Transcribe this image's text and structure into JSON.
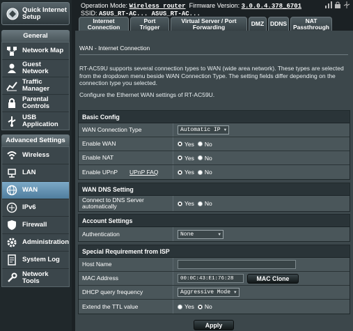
{
  "header": {
    "operation_mode_label": "Operation Mode:",
    "operation_mode_value": "Wireless router",
    "firmware_label": "Firmware Version:",
    "firmware_value": "3.0.0.4.378_6701",
    "ssid_label": "SSID:",
    "ssid_value": "ASUS_RT-AC...  ASUS_RT-AC..."
  },
  "sidebar": {
    "quick_setup_label": "Quick Internet\nSetup",
    "general_label": "General",
    "general_items": [
      {
        "label": "Network Map",
        "icon": "network-map-icon"
      },
      {
        "label": "Guest\nNetwork",
        "icon": "guest-network-icon"
      },
      {
        "label": "Traffic\nManager",
        "icon": "traffic-manager-icon"
      },
      {
        "label": "Parental\nControls",
        "icon": "parental-controls-icon"
      },
      {
        "label": "USB\nApplication",
        "icon": "usb-application-icon"
      }
    ],
    "advanced_label": "Advanced Settings",
    "advanced_items": [
      {
        "label": "Wireless",
        "icon": "wireless-icon"
      },
      {
        "label": "LAN",
        "icon": "lan-icon"
      },
      {
        "label": "WAN",
        "icon": "wan-icon",
        "active": true
      },
      {
        "label": "IPv6",
        "icon": "ipv6-icon"
      },
      {
        "label": "Firewall",
        "icon": "firewall-icon"
      },
      {
        "label": "Administration",
        "icon": "administration-icon"
      },
      {
        "label": "System Log",
        "icon": "system-log-icon"
      },
      {
        "label": "Network\nTools",
        "icon": "network-tools-icon"
      }
    ]
  },
  "tabs": [
    {
      "label": "Internet\nConnection",
      "active": true
    },
    {
      "label": "Port\nTrigger"
    },
    {
      "label": "Virtual Server / Port\nForwarding"
    },
    {
      "label": "DMZ"
    },
    {
      "label": "DDNS"
    },
    {
      "label": "NAT\nPassthrough"
    }
  ],
  "main": {
    "title": "WAN - Internet Connection",
    "description": "RT-AC59U supports several connection types to WAN (wide area network). These types are selected from the dropdown menu beside WAN Connection Type. The setting fields differ depending on the connection type you selected.",
    "configure_text": "Configure the Ethernet WAN settings of RT-AC59U.",
    "yes_label": "Yes",
    "no_label": "No",
    "basic_config": {
      "header": "Basic Config",
      "wan_connection_type_label": "WAN Connection Type",
      "wan_connection_type_value": "Automatic IP",
      "enable_wan_label": "Enable WAN",
      "enable_nat_label": "Enable NAT",
      "enable_upnp_label": "Enable UPnP",
      "upnp_faq_label": "UPnP FAQ"
    },
    "wan_dns": {
      "header": "WAN DNS Setting",
      "connect_dns_label": "Connect to DNS Server\nautomatically"
    },
    "account": {
      "header": "Account Settings",
      "auth_label": "Authentication",
      "auth_value": "None"
    },
    "isp": {
      "header": "Special Requirement from ISP",
      "host_name_label": "Host Name",
      "host_name_value": "",
      "mac_label": "MAC Address",
      "mac_value": "00:0C:43:E1:76:28",
      "mac_clone_label": "MAC Clone",
      "dhcp_freq_label": "DHCP query frequency",
      "dhcp_freq_value": "Aggressive Mode",
      "ttl_label": "Extend the TTL value"
    },
    "apply_label": "Apply"
  }
}
